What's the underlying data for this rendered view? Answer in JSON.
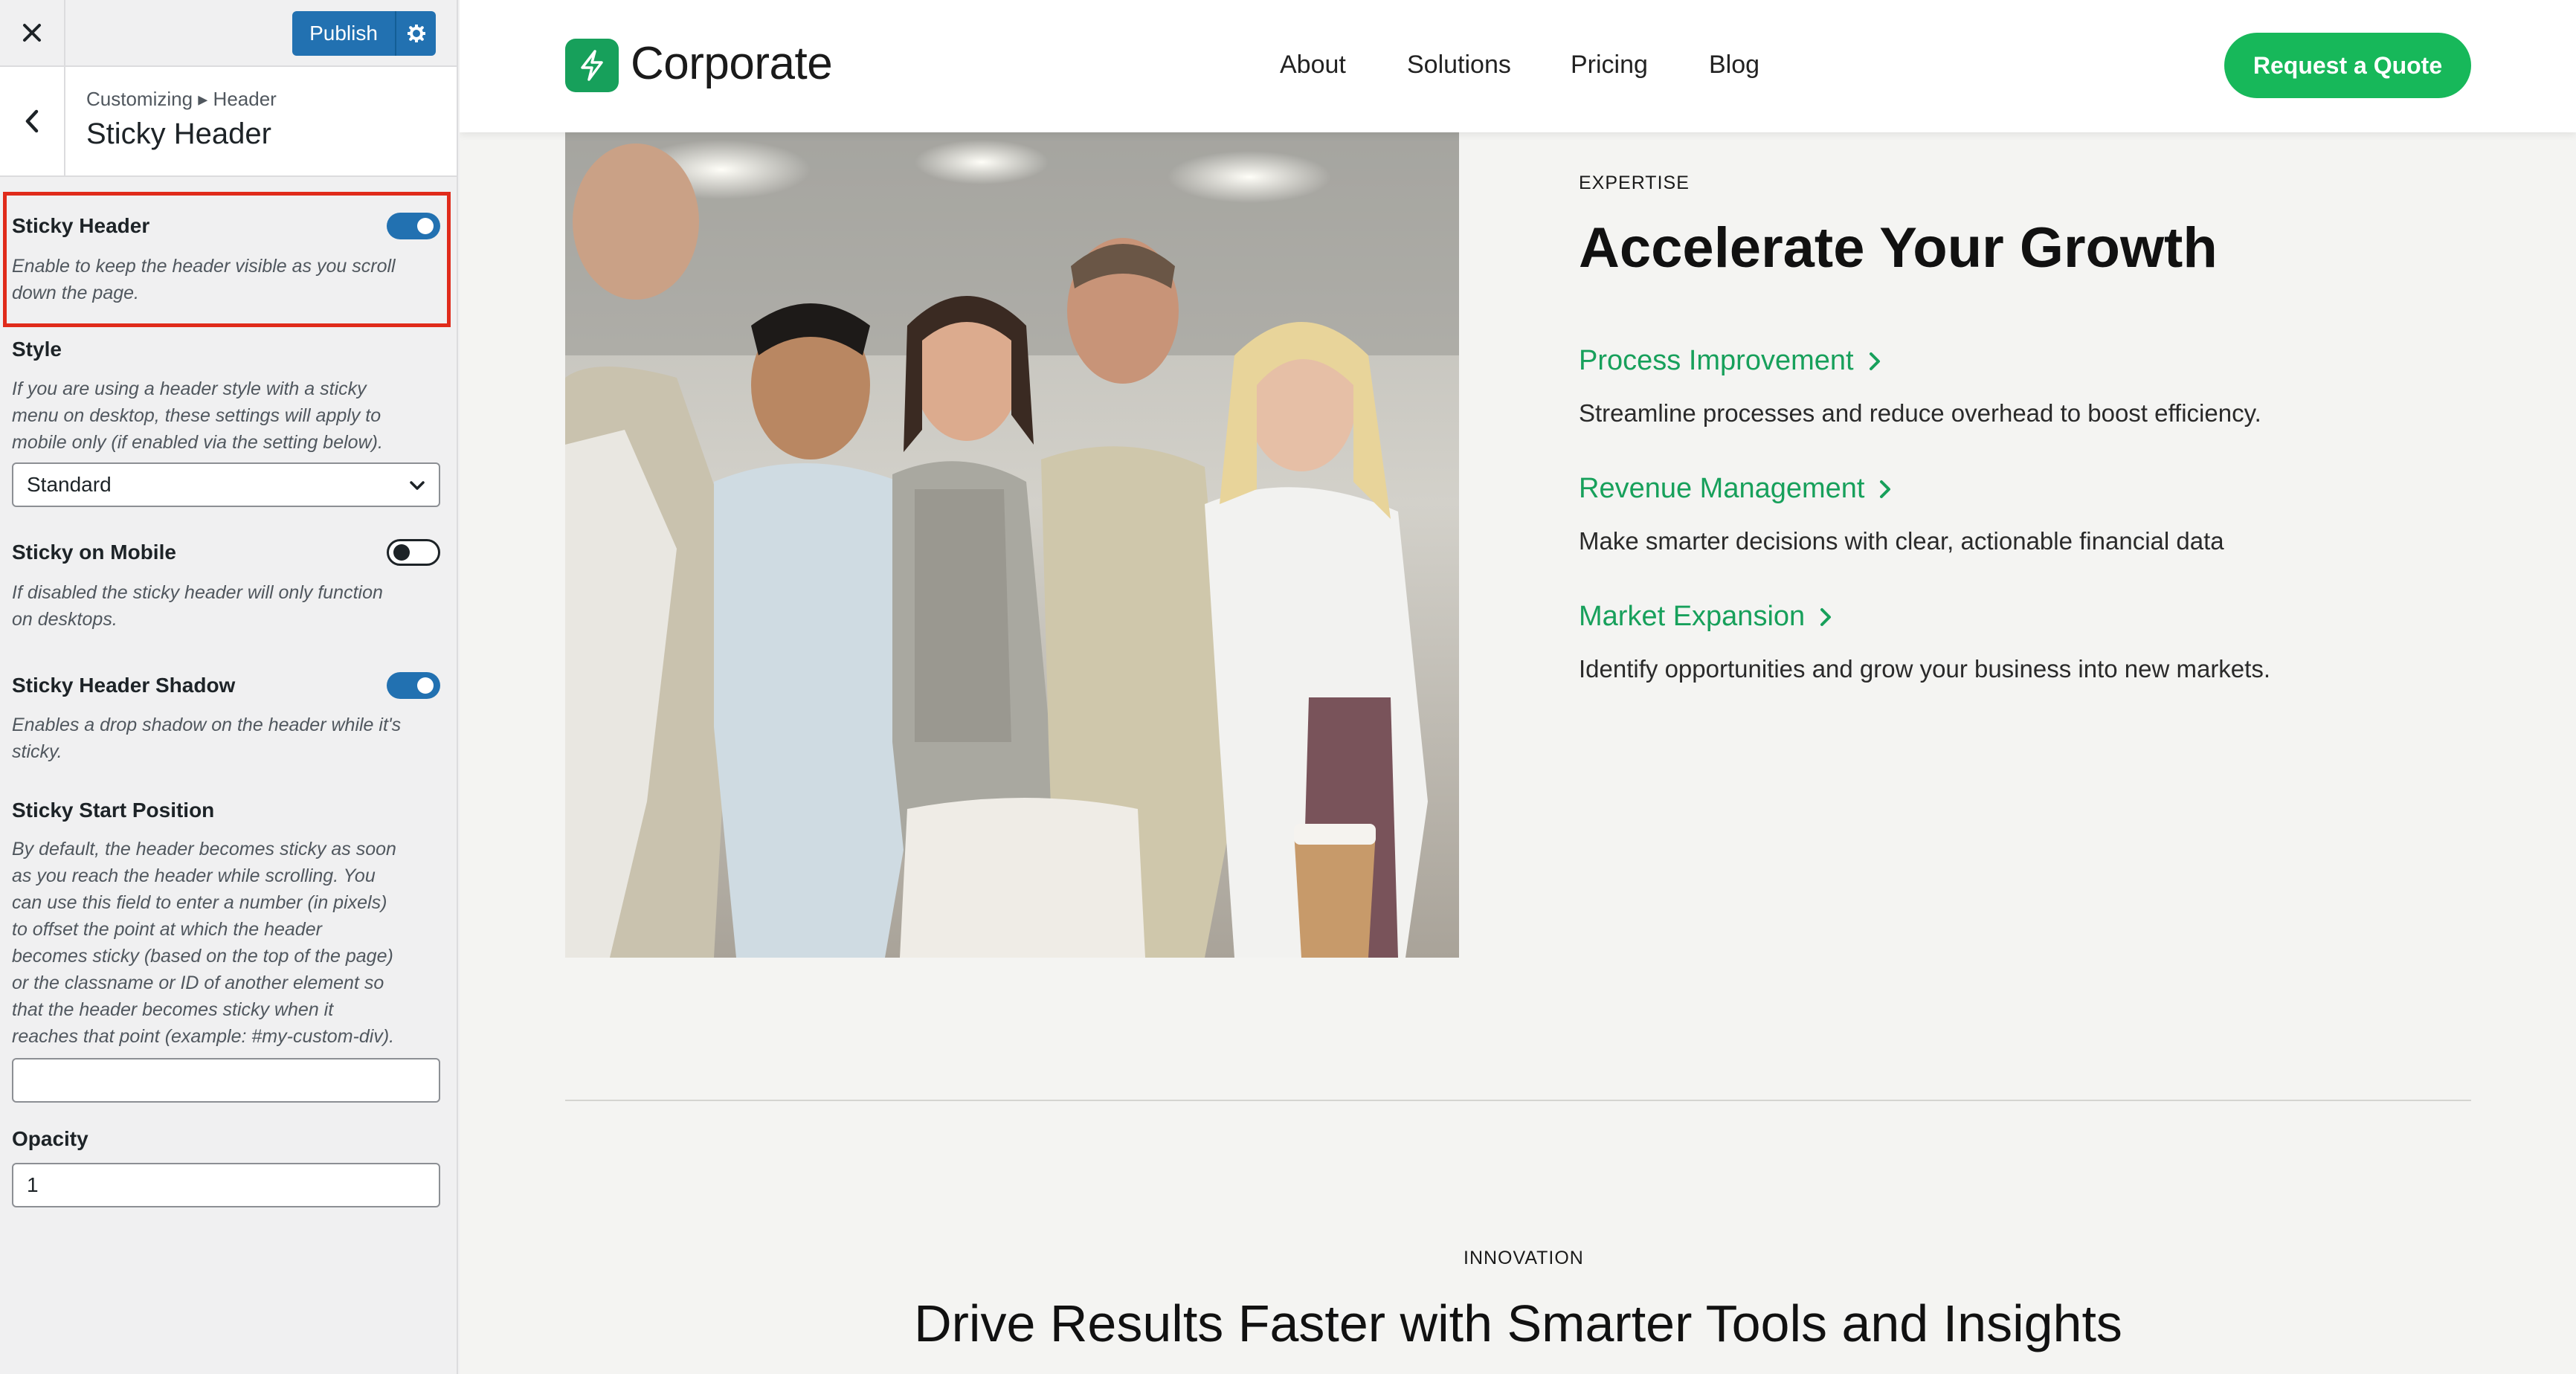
{
  "customizer": {
    "publish_label": "Publish",
    "breadcrumb": "Customizing ▸ Header",
    "section_title": "Sticky Header",
    "controls": {
      "sticky_header": {
        "label": "Sticky Header",
        "enabled": true,
        "desc_1": "Enable to keep the header visible as you scroll",
        "desc_2": "down the page."
      },
      "style": {
        "label": "Style",
        "desc_1": "If you are using a header style with a sticky",
        "desc_2": "menu on desktop, these settings will apply to",
        "desc_3": "mobile only (if enabled via the setting below).",
        "value": "Standard"
      },
      "sticky_mobile": {
        "label": "Sticky on Mobile",
        "enabled": false,
        "desc_1": "If disabled the sticky header will only function",
        "desc_2": "on desktops."
      },
      "sticky_shadow": {
        "label": "Sticky Header Shadow",
        "enabled": true,
        "desc_1": "Enables a drop shadow on the header while it's",
        "desc_2": "sticky."
      },
      "start_position": {
        "label": "Sticky Start Position",
        "desc_lines": [
          "By default, the header becomes sticky as soon",
          "as you reach the header while scrolling. You",
          "can use this field to enter a number (in pixels)",
          "to offset the point at which the header",
          "becomes sticky (based on the top of the page)",
          "or the classname or ID of another element so",
          "that the header becomes sticky when it",
          "reaches that point (example: #my-custom-div)."
        ],
        "value": ""
      },
      "opacity": {
        "label": "Opacity",
        "value": "1"
      }
    }
  },
  "site": {
    "logo_text": "Corporate",
    "nav": [
      "About",
      "Solutions",
      "Pricing",
      "Blog"
    ],
    "cta_label": "Request a Quote",
    "expertise": {
      "eyebrow": "EXPERTISE",
      "title": "Accelerate Your Growth",
      "features": [
        {
          "title": "Process Improvement",
          "desc": "Streamline processes and reduce overhead to boost efficiency."
        },
        {
          "title": "Revenue Management",
          "desc": "Make smarter decisions with clear, actionable financial data"
        },
        {
          "title": "Market Expansion",
          "desc": "Identify opportunities and grow your business into new markets."
        }
      ]
    },
    "innovation": {
      "eyebrow": "INNOVATION",
      "title": "Drive Results Faster with Smarter Tools and Insights"
    }
  },
  "colors": {
    "wp_blue": "#2271b1",
    "brand_green": "#17a05b",
    "cta_green": "#17b85a",
    "highlight_red": "#e02b1b"
  },
  "icons": [
    "close-icon",
    "gear-icon",
    "back-chevron-icon",
    "chevron-down-icon",
    "lightning-bolt-icon",
    "chevron-right-icon"
  ]
}
